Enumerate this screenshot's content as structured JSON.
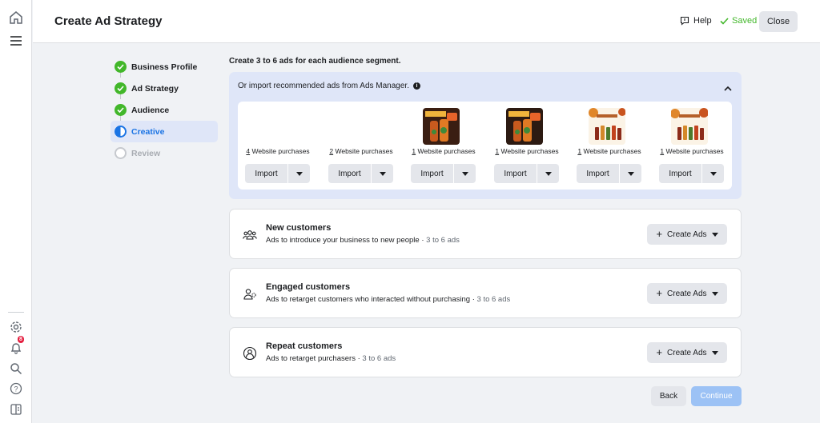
{
  "header": {
    "title": "Create Ad Strategy",
    "help_label": "Help",
    "saved_label": "Saved",
    "close_label": "Close"
  },
  "rail": {
    "notification_count": "8",
    "icons": [
      "home-icon",
      "menu-icon",
      "settings-icon",
      "notifications-icon",
      "search-icon",
      "help-icon",
      "panel-icon"
    ]
  },
  "steps": [
    {
      "label": "Business Profile",
      "status": "done"
    },
    {
      "label": "Ad Strategy",
      "status": "done"
    },
    {
      "label": "Audience",
      "status": "done"
    },
    {
      "label": "Creative",
      "status": "active"
    },
    {
      "label": "Review",
      "status": "disabled"
    }
  ],
  "main": {
    "intro": "Create 3 to 6 ads for each audience segment.",
    "import_heading": "Or import recommended ads from Ads Manager.",
    "import_label": "Import",
    "ads": [
      {
        "count": "4",
        "caption": " Website purchases",
        "thumb": "none"
      },
      {
        "count": "2",
        "caption": " Website purchases",
        "thumb": "none"
      },
      {
        "count": "1",
        "caption": " Website purchases",
        "thumb": "bundle-deal"
      },
      {
        "count": "1",
        "caption": " Website purchases",
        "thumb": "bundle-deal"
      },
      {
        "count": "1",
        "caption": " Website purchases",
        "thumb": "thanksgiving"
      },
      {
        "count": "1",
        "caption": " Website purchases",
        "thumb": "thanksgiving"
      }
    ]
  },
  "segments": [
    {
      "title": "New customers",
      "desc": "Ads to introduce your business to new people",
      "range": "3 to 6 ads",
      "icon": "people-group-icon",
      "button": "Create Ads"
    },
    {
      "title": "Engaged customers",
      "desc": "Ads to retarget customers who interacted without purchasing",
      "range": "3 to 6 ads",
      "icon": "person-engaged-icon",
      "button": "Create Ads"
    },
    {
      "title": "Repeat customers",
      "desc": "Ads to retarget purchasers",
      "range": "3 to 6 ads",
      "icon": "person-repeat-icon",
      "button": "Create Ads"
    }
  ],
  "footer": {
    "back_label": "Back",
    "continue_label": "Continue"
  },
  "colors": {
    "accent": "#1b74e4",
    "success": "#42b72a",
    "panel": "#dfe6f8",
    "button": "#e4e6eb",
    "continue_disabled": "#9cc2f5"
  }
}
